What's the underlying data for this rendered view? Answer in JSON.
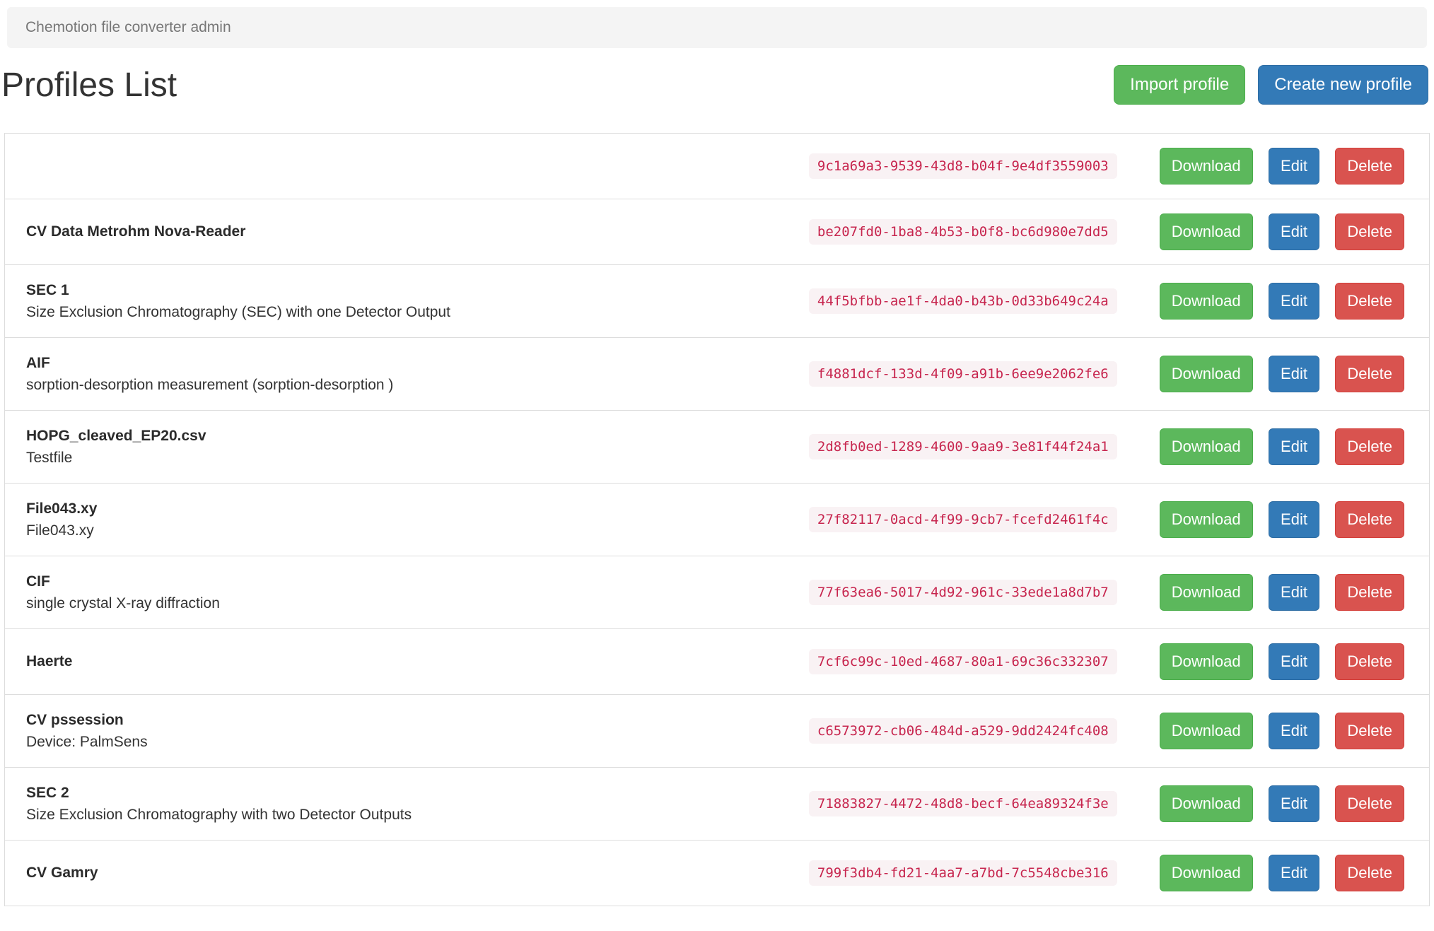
{
  "topbar": {
    "title": "Chemotion file converter admin"
  },
  "header": {
    "title": "Profiles List",
    "import_label": "Import profile",
    "create_label": "Create new profile"
  },
  "actions": {
    "download": "Download",
    "edit": "Edit",
    "delete": "Delete"
  },
  "colors": {
    "success_green": "#5cb85c",
    "primary_blue": "#337ab7",
    "danger_red": "#d9534f",
    "code_text": "#c7254e",
    "code_background": "#f9f2f4"
  },
  "profiles": [
    {
      "title": "",
      "description": "",
      "id": "9c1a69a3-9539-43d8-b04f-9e4df3559003"
    },
    {
      "title": "CV Data Metrohm Nova-Reader",
      "description": "",
      "id": "be207fd0-1ba8-4b53-b0f8-bc6d980e7dd5"
    },
    {
      "title": "SEC 1",
      "description": "Size Exclusion Chromatography (SEC) with one Detector Output",
      "id": "44f5bfbb-ae1f-4da0-b43b-0d33b649c24a"
    },
    {
      "title": "AIF",
      "description": "sorption-desorption measurement (sorption-desorption )",
      "id": "f4881dcf-133d-4f09-a91b-6ee9e2062fe6"
    },
    {
      "title": "HOPG_cleaved_EP20.csv",
      "description": "Testfile",
      "id": "2d8fb0ed-1289-4600-9aa9-3e81f44f24a1"
    },
    {
      "title": "File043.xy",
      "description": "File043.xy",
      "id": "27f82117-0acd-4f99-9cb7-fcefd2461f4c"
    },
    {
      "title": "CIF",
      "description": "single crystal X-ray diffraction",
      "id": "77f63ea6-5017-4d92-961c-33ede1a8d7b7"
    },
    {
      "title": "Haerte",
      "description": "",
      "id": "7cf6c99c-10ed-4687-80a1-69c36c332307"
    },
    {
      "title": "CV pssession",
      "description": "Device: PalmSens",
      "id": "c6573972-cb06-484d-a529-9dd2424fc408"
    },
    {
      "title": "SEC 2",
      "description": "Size Exclusion Chromatography with two Detector Outputs",
      "id": "71883827-4472-48d8-becf-64ea89324f3e"
    },
    {
      "title": "CV Gamry",
      "description": "",
      "id": "799f3db4-fd21-4aa7-a7bd-7c5548cbe316"
    }
  ]
}
